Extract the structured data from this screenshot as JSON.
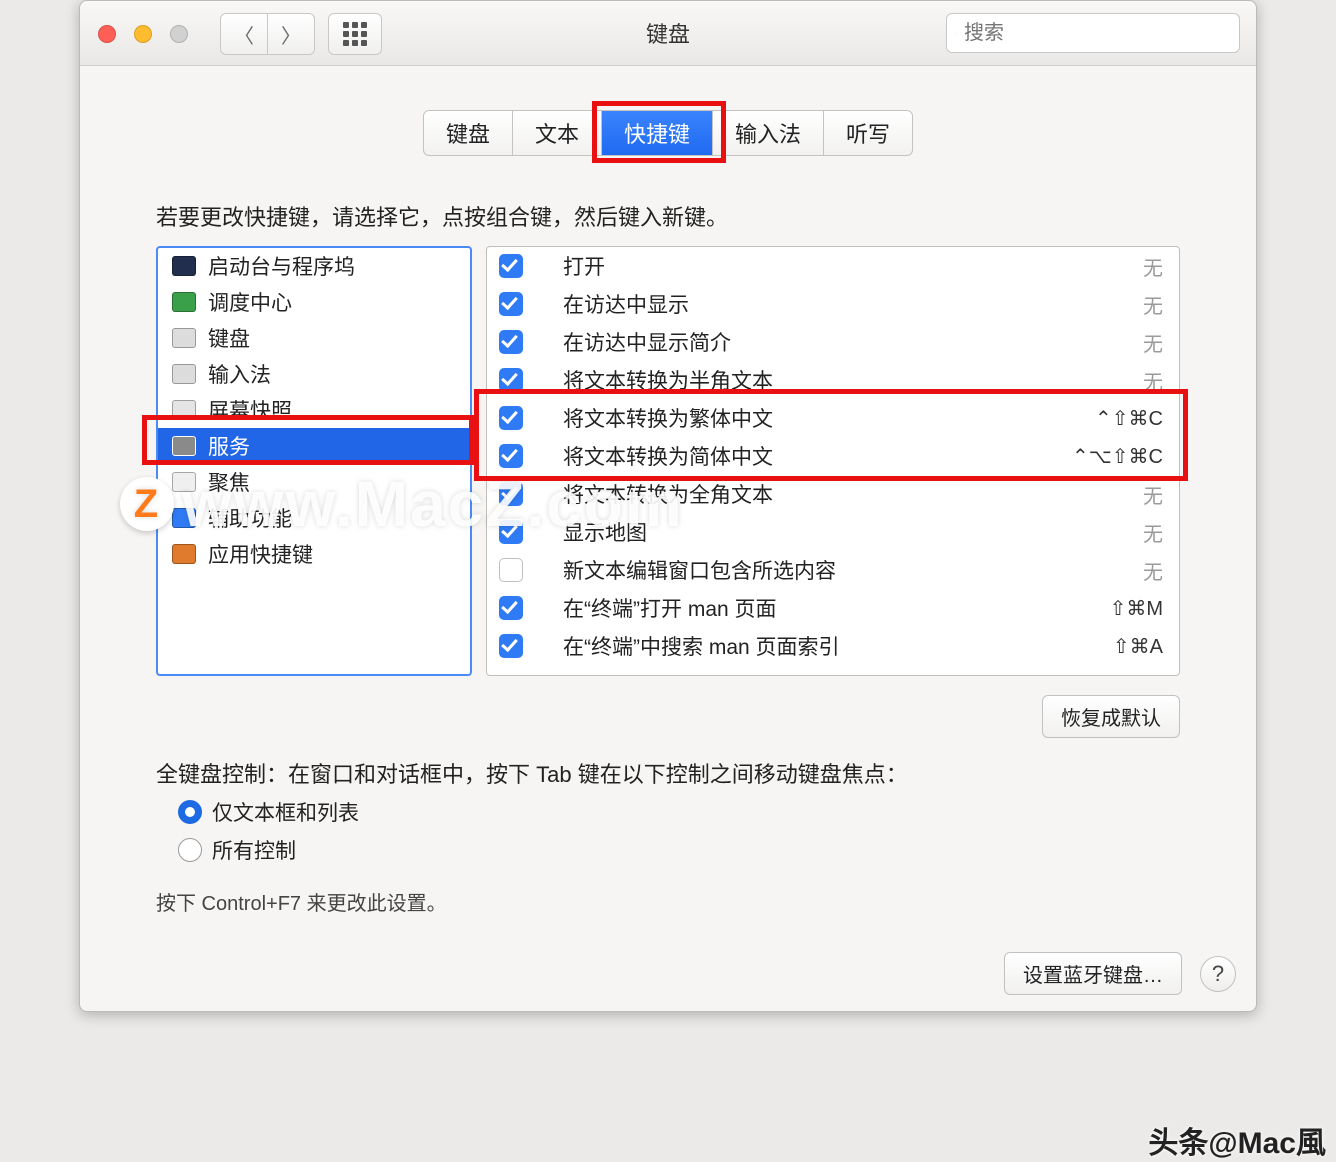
{
  "window": {
    "title": "键盘",
    "search_placeholder": "搜索"
  },
  "tabs": [
    {
      "label": "键盘",
      "selected": false
    },
    {
      "label": "文本",
      "selected": false
    },
    {
      "label": "快捷键",
      "selected": true
    },
    {
      "label": "输入法",
      "selected": false
    },
    {
      "label": "听写",
      "selected": false
    }
  ],
  "instruction": "若要更改快捷键，请选择它，点按组合键，然后键入新键。",
  "categories": [
    {
      "label": "启动台与程序坞",
      "icon_bg": "#222e4d"
    },
    {
      "label": "调度中心",
      "icon_bg": "#3ba04a"
    },
    {
      "label": "键盘",
      "icon_bg": "#dcdcdc"
    },
    {
      "label": "输入法",
      "icon_bg": "#dcdcdc"
    },
    {
      "label": "屏幕快照",
      "icon_bg": "#e4e4e4"
    },
    {
      "label": "服务",
      "icon_bg": "#8a8a8a",
      "selected": true
    },
    {
      "label": "聚焦",
      "icon_bg": "#efefef"
    },
    {
      "label": "辅助功能",
      "icon_bg": "#2f7bf6"
    },
    {
      "label": "应用快捷键",
      "icon_bg": "#e07a2c"
    }
  ],
  "shortcuts": [
    {
      "checked": true,
      "label": "打开",
      "key": "无",
      "key_none": true
    },
    {
      "checked": true,
      "label": "在访达中显示",
      "key": "无",
      "key_none": true
    },
    {
      "checked": true,
      "label": "在访达中显示简介",
      "key": "无",
      "key_none": true
    },
    {
      "checked": true,
      "label": "将文本转换为半角文本",
      "key": "无",
      "key_none": true
    },
    {
      "checked": true,
      "label": "将文本转换为繁体中文",
      "key": "⌃⇧⌘C",
      "key_none": false
    },
    {
      "checked": true,
      "label": "将文本转换为简体中文",
      "key": "⌃⌥⇧⌘C",
      "key_none": false
    },
    {
      "checked": true,
      "label": "将文本转换为全角文本",
      "key": "无",
      "key_none": true
    },
    {
      "checked": true,
      "label": "显示地图",
      "key": "无",
      "key_none": true
    },
    {
      "checked": false,
      "label": "新文本编辑窗口包含所选内容",
      "key": "无",
      "key_none": true
    },
    {
      "checked": true,
      "label": "在“终端”打开 man 页面",
      "key": "⇧⌘M",
      "key_none": false
    },
    {
      "checked": true,
      "label": "在“终端”中搜索 man 页面索引",
      "key": "⇧⌘A",
      "key_none": false
    }
  ],
  "buttons": {
    "restore_defaults": "恢复成默认",
    "setup_bluetooth_kb": "设置蓝牙键盘…"
  },
  "full_keyboard": {
    "heading": "全键盘控制：在窗口和对话框中，按下 Tab 键在以下控制之间移动键盘焦点：",
    "opt_text_only": "仅文本框和列表",
    "opt_all": "所有控制",
    "selected": "text_only",
    "hint": "按下 Control+F7 来更改此设置。"
  },
  "watermark": "www.MacZ.com",
  "footer_watermark": "头条@Mac風"
}
